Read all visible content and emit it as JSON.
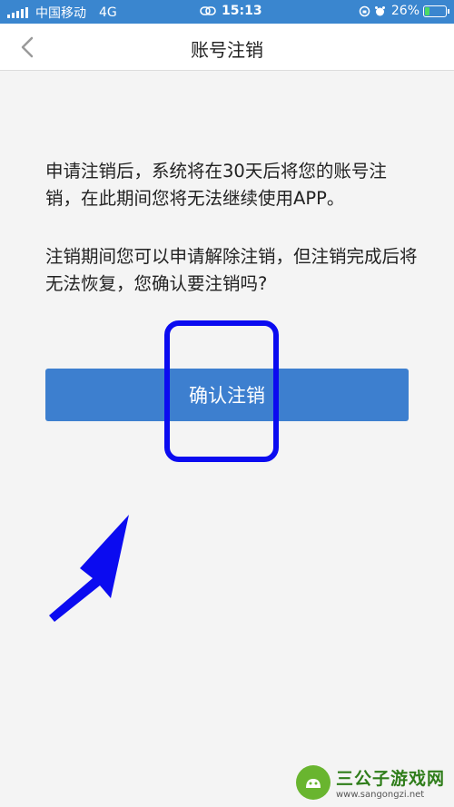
{
  "status_bar": {
    "carrier": "中国移动",
    "network": "4G",
    "time": "15:13",
    "battery_percent": "26%",
    "battery_level": 0.26
  },
  "nav": {
    "title": "账号注销",
    "back_icon": "chevron-left-icon"
  },
  "content": {
    "paragraph_1": "申请注销后，系统将在30天后将您的账号注销，在此期间您将无法继续使用APP。",
    "paragraph_2": "注销期间您可以申请解除注销，但注销完成后将无法恢复，您确认要注销吗?",
    "confirm_button_label": "确认注销"
  },
  "annotations": {
    "highlight_color": "#0b0bf0",
    "arrow_color": "#0b0bf0"
  },
  "watermark": {
    "name": "三公子游戏网",
    "url": "www.sangongzi.net"
  },
  "colors": {
    "status_bar": "#3a86cf",
    "button": "#3d7fcf",
    "background": "#f4f4f4"
  }
}
